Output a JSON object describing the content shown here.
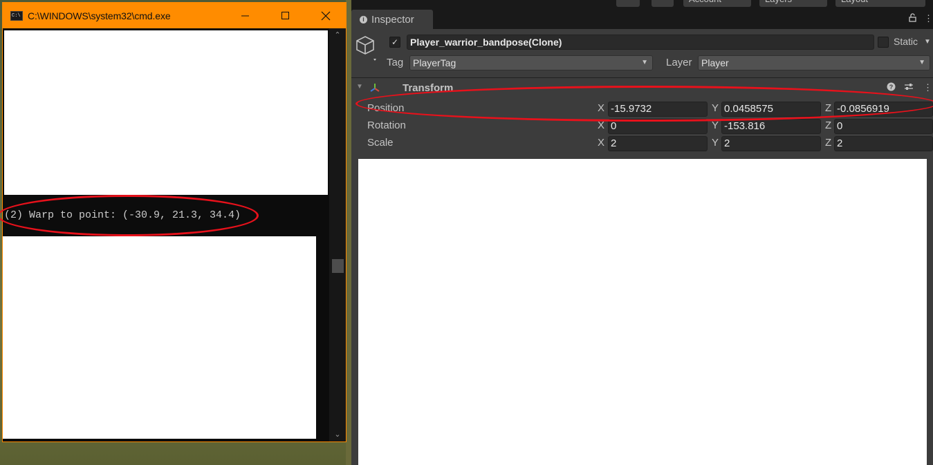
{
  "cmd": {
    "title": "C:\\WINDOWS\\system32\\cmd.exe",
    "icon": "cmd-icon",
    "icon_text": "C:\\",
    "output_line": "(2) Warp to point: (-30.9, 21.3, 34.4)"
  },
  "unity_toolbar": {
    "account_label": "Account",
    "layers_label": "Layers",
    "layout_label": "Layout"
  },
  "inspector": {
    "tab_label": "Inspector",
    "object_name": "Player_warrior_bandpose(Clone)",
    "active": true,
    "static_label": "Static",
    "tag_label": "Tag",
    "tag_value": "PlayerTag",
    "layer_label": "Layer",
    "layer_value": "Player",
    "component_title": "Transform",
    "position": {
      "label": "Position",
      "x": "-15.9732",
      "y": "0.0458575",
      "z": "-0.0856919"
    },
    "rotation": {
      "label": "Rotation",
      "x": "0",
      "y": "-153.816",
      "z": "0"
    },
    "scale": {
      "label": "Scale",
      "x": "2",
      "y": "2",
      "z": "2"
    },
    "axis_x": "X",
    "axis_y": "Y",
    "axis_z": "Z"
  },
  "colors": {
    "cmd_title_bar": "#ff8c00",
    "highlight": "#e8111b",
    "unity_panel": "#3c3c3c"
  }
}
